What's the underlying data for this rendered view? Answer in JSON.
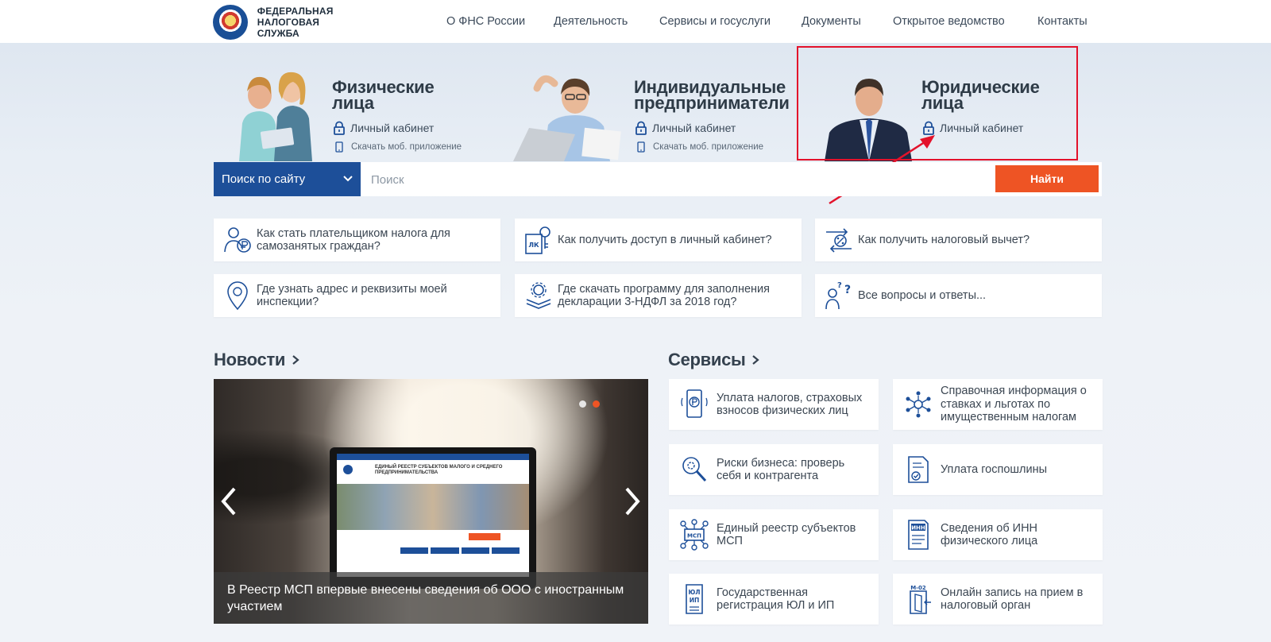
{
  "header": {
    "logo_line1": "ФЕДЕРАЛЬНАЯ",
    "logo_line2": "НАЛОГОВАЯ СЛУЖБА",
    "nav": [
      {
        "label": "О ФНС России"
      },
      {
        "label": "Деятельность"
      },
      {
        "label": "Сервисы и госуслуги"
      },
      {
        "label": "Документы"
      },
      {
        "label": "Открытое ведомство"
      },
      {
        "label": "Контакты"
      }
    ]
  },
  "hero": {
    "cards": [
      {
        "title_line1": "Физические",
        "title_line2": "лица",
        "cabinet": "Личный кабинет",
        "app": "Скачать моб. приложение"
      },
      {
        "title_line1": "Индивидуальные",
        "title_line2": "предприниматели",
        "cabinet": "Личный кабинет",
        "app": "Скачать моб. приложение"
      },
      {
        "title_line1": "Юридические",
        "title_line2": "лица",
        "cabinet": "Личный кабинет"
      }
    ]
  },
  "search": {
    "scope": "Поиск по сайту",
    "placeholder": "Поиск",
    "button": "Найти"
  },
  "quick_links": [
    {
      "text_line1": "Как стать плательщиком налога для",
      "text_line2": "самозанятых граждан?"
    },
    {
      "text_line1": "Как получить доступ в личный кабинет?",
      "text_line2": ""
    },
    {
      "text_line1": "Как получить налоговый вычет?",
      "text_line2": ""
    },
    {
      "text_line1": "Где узнать адрес и реквизиты моей",
      "text_line2": "инспекции?"
    },
    {
      "text_line1": "Где скачать программу для заполнения",
      "text_line2": "декларации 3-НДФЛ за 2018 год?"
    },
    {
      "text_line1": "Все вопросы и ответы...",
      "text_line2": ""
    }
  ],
  "news": {
    "title": "Новости",
    "caption": "В Реестр МСП впервые внесены сведения об ООО с иностранным участием",
    "screen_title_line1": "ЕДИНЫЙ РЕЕСТР СУБЪЕКТОВ МАЛОГО И СРЕДНЕГО",
    "screen_title_line2": "ПРЕДПРИНИМАТЕЛЬСТВА"
  },
  "services": {
    "title": "Сервисы",
    "items": [
      {
        "line1": "Уплата налогов, страховых",
        "line2": "взносов физических лиц",
        "line3": ""
      },
      {
        "line1": "Справочная информация о",
        "line2": "ставках и льготах по",
        "line3": "имущественным налогам"
      },
      {
        "line1": "Риски бизнеса: проверь",
        "line2": "себя и контрагента",
        "line3": ""
      },
      {
        "line1": "Уплата госпошлины",
        "line2": "",
        "line3": ""
      },
      {
        "line1": "Единый реестр субъектов",
        "line2": "МСП",
        "line3": ""
      },
      {
        "line1": "Сведения об ИНН",
        "line2": "физического лица",
        "line3": ""
      },
      {
        "line1": "Государственная",
        "line2": "регистрация ЮЛ и ИП",
        "line3": ""
      },
      {
        "line1": "Онлайн запись на прием в",
        "line2": "налоговый орган",
        "line3": ""
      }
    ]
  },
  "colors": {
    "brand_blue": "#1d4f99",
    "accent_orange": "#ee5424",
    "highlight_red": "#e3122b"
  },
  "icon_labels": {
    "lk": "ЛК",
    "msp": "МСП",
    "inn": "ИНН",
    "ul": "ЮЛ",
    "ip": "ИП",
    "m02": "М-02"
  }
}
